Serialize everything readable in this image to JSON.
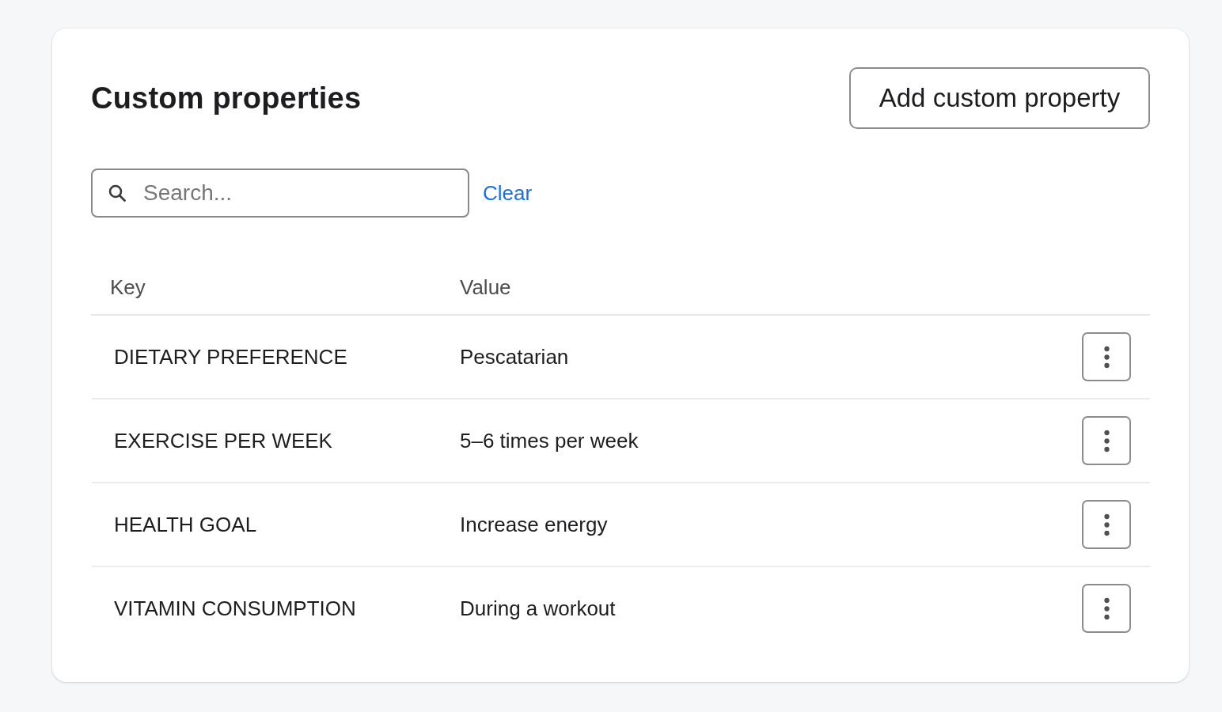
{
  "card": {
    "title": "Custom properties",
    "add_button": "Add custom property"
  },
  "search": {
    "placeholder": "Search...",
    "clear_link": "Clear"
  },
  "table": {
    "columns": [
      "Key",
      "Value"
    ],
    "rows": [
      {
        "key": "DIETARY PREFERENCE",
        "value": "Pescatarian"
      },
      {
        "key": "EXERCISE PER WEEK",
        "value": "5–6 times per week"
      },
      {
        "key": "HEALTH GOAL",
        "value": "Increase energy"
      },
      {
        "key": "VITAMIN CONSUMPTION",
        "value": "During a workout"
      }
    ]
  }
}
